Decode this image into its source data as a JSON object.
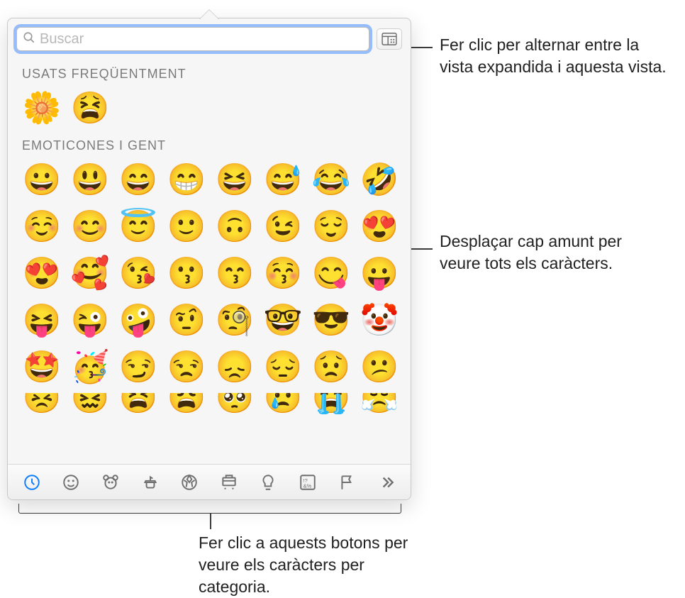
{
  "search": {
    "placeholder": "Buscar"
  },
  "sections": {
    "frequent": {
      "title": "USATS FREQÜENTMENT",
      "items": [
        "🌼",
        "😫"
      ]
    },
    "smileys": {
      "title": "EMOTICONES I GENT",
      "rows": [
        [
          "😀",
          "😃",
          "😄",
          "😁",
          "😆",
          "😅",
          "😂",
          "🤣"
        ],
        [
          "☺️",
          "😊",
          "😇",
          "🙂",
          "🙃",
          "😉",
          "😌",
          "😍"
        ],
        [
          "😍",
          "🥰",
          "😘",
          "😗",
          "😙",
          "😚",
          "😋",
          "😛"
        ],
        [
          "😝",
          "😜",
          "🤪",
          "🤨",
          "🧐",
          "🤓",
          "😎",
          "🤡"
        ],
        [
          "🤩",
          "🥳",
          "😏",
          "😒",
          "😞",
          "😔",
          "😟",
          "😕"
        ]
      ],
      "partialRow": [
        "😣",
        "😖",
        "😫",
        "😩",
        "🥺",
        "😢",
        "😭",
        "😤"
      ]
    }
  },
  "categories": [
    {
      "name": "recent",
      "active": true
    },
    {
      "name": "smileys",
      "active": false
    },
    {
      "name": "animals",
      "active": false
    },
    {
      "name": "food",
      "active": false
    },
    {
      "name": "activity",
      "active": false
    },
    {
      "name": "travel",
      "active": false
    },
    {
      "name": "objects",
      "active": false
    },
    {
      "name": "symbols",
      "active": false
    },
    {
      "name": "flags",
      "active": false
    },
    {
      "name": "more",
      "active": false
    }
  ],
  "callouts": {
    "expand": "Fer clic per alternar entre la vista expandida i aquesta vista.",
    "scroll": "Desplaçar cap amunt per veure tots els caràcters.",
    "categories": "Fer clic a aquests botons per veure els caràcters per categoria."
  }
}
